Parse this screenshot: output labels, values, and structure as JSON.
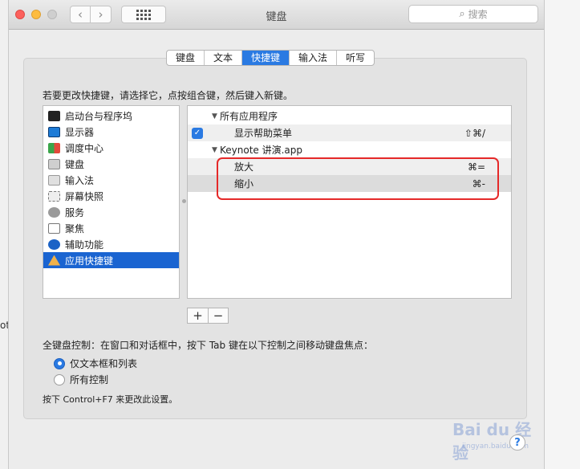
{
  "window": {
    "title": "键盘",
    "search_placeholder": "搜索"
  },
  "tabs": [
    {
      "label": "键盘",
      "active": false
    },
    {
      "label": "文本",
      "active": false
    },
    {
      "label": "快捷键",
      "active": true
    },
    {
      "label": "输入法",
      "active": false
    },
    {
      "label": "听写",
      "active": false
    }
  ],
  "instruction": "若要更改快捷键，请选择它，点按组合键，然后键入新键。",
  "categories": [
    {
      "label": "启动台与程序坞",
      "icon": "launchpad-icon"
    },
    {
      "label": "显示器",
      "icon": "display-icon"
    },
    {
      "label": "调度中心",
      "icon": "mission-control-icon"
    },
    {
      "label": "键盘",
      "icon": "keyboard-icon"
    },
    {
      "label": "输入法",
      "icon": "input-method-icon"
    },
    {
      "label": "屏幕快照",
      "icon": "screenshot-icon"
    },
    {
      "label": "服务",
      "icon": "gear-icon"
    },
    {
      "label": "聚焦",
      "icon": "spotlight-icon"
    },
    {
      "label": "辅助功能",
      "icon": "accessibility-icon"
    },
    {
      "label": "应用快捷键",
      "icon": "app-shortcuts-icon",
      "selected": true
    }
  ],
  "shortcuts": {
    "group_all": "所有应用程序",
    "item_help": {
      "name": "显示帮助菜单",
      "key": "⇧⌘/",
      "checked": true
    },
    "group_keynote": "Keynote 讲演.app",
    "item_zoom_in": {
      "name": "放大",
      "key": "⌘="
    },
    "item_zoom_out": {
      "name": "缩小",
      "key": "⌘-"
    }
  },
  "buttons": {
    "add": "+",
    "remove": "−"
  },
  "full_keyboard": {
    "label": "全键盘控制：在窗口和对话框中，按下 Tab 键在以下控制之间移动键盘焦点：",
    "option_text_lists": "仅文本框和列表",
    "option_all": "所有控制",
    "selected": "option_text_lists",
    "hint": "按下 Control+F7 来更改此设置。"
  },
  "help_label": "?",
  "watermark": {
    "brand": "Bai du 经验",
    "sub": "jingyan.baidu.com"
  },
  "background_text": "ot",
  "colors": {
    "accent": "#2a7ae2",
    "selection": "#1a64d1",
    "annotation": "#e52929"
  }
}
